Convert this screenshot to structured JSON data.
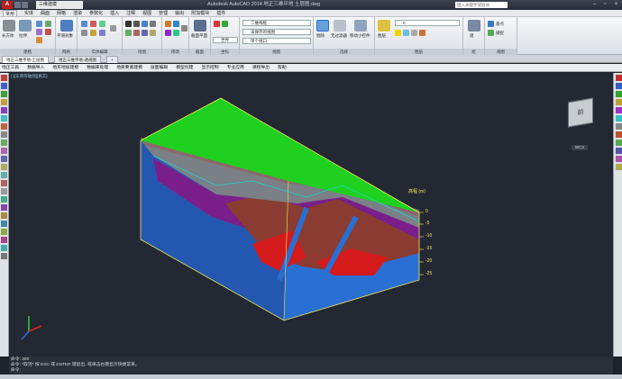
{
  "title_bar": {
    "app_button": "A",
    "workspace": "三维建模",
    "title": "Autodesk AutoCAD 2014  地正三维平地 土层图.dwg",
    "search_placeholder": "键入关键字或短语",
    "win_minimize": "–",
    "win_restore": "▫",
    "win_close": "×"
  },
  "menu": {
    "items": [
      "常用",
      "实体",
      "曲面",
      "网格",
      "渲染",
      "参数化",
      "插入",
      "注释",
      "视图",
      "管理",
      "输出",
      "附加模块",
      "插件"
    ],
    "active_index": 0
  },
  "ribbon": {
    "panel_labels": [
      "建模",
      "网格",
      "实体编辑",
      "绘图",
      "修改",
      "截面",
      "坐标",
      "视图",
      "选择",
      "图层",
      "组",
      "视图"
    ],
    "buttons": {
      "box": "长方体",
      "extrude": "拉伸",
      "smooth": "平滑对象",
      "section_plane": "截面平面",
      "view_panel_combo1": "二维线框",
      "view_panel_combo2": "未保存的视图",
      "view_panel_combo3": "单个视口",
      "world": "世界",
      "culling": "剔除",
      "no_filter": "无过滤器",
      "move_gizmo": "移动小控件",
      "layers": "图层",
      "layer_combo": "0",
      "group": "组",
      "base": "基点",
      "snap": "捕捉"
    }
  },
  "file_tabs": [
    {
      "label": "地正三维平地-土层图",
      "active": true
    },
    {
      "label": "地正三维平地-透视图",
      "active": false
    },
    {
      "label": "+",
      "active": false
    }
  ],
  "plugin_menu": [
    "地正工具",
    "数据导入",
    "地形地层建模",
    "数据库处理",
    "地质要素建模",
    "层面编辑",
    "模型创建",
    "显示控制",
    "专业应用",
    "课程导出",
    "帮助"
  ],
  "viewport": {
    "controls": "[-][东南等轴测][真实]",
    "viewcube_label": "前",
    "viewcube_wcs": "WCS",
    "axis_label": "高程 (m)",
    "axis_ticks": [
      "0",
      "-5",
      "-10",
      "-15",
      "-20",
      "-25"
    ],
    "colors": {
      "top": "#1fd01f",
      "front": "#2a6fd2",
      "side": "#2458b0",
      "rock_purple": "#7a1e8c",
      "rock_brown": "#8a3c32",
      "rock_red": "#d41a1a",
      "grey_layer": "#7b7f86",
      "edge": "#f0e85a"
    }
  },
  "command_line": {
    "line1": "命令: 300",
    "line2": "命令: *取消* 按 ESC 或 ENTER 键退出, 或单击右键显示快捷菜单。",
    "prompt": "命令:"
  }
}
